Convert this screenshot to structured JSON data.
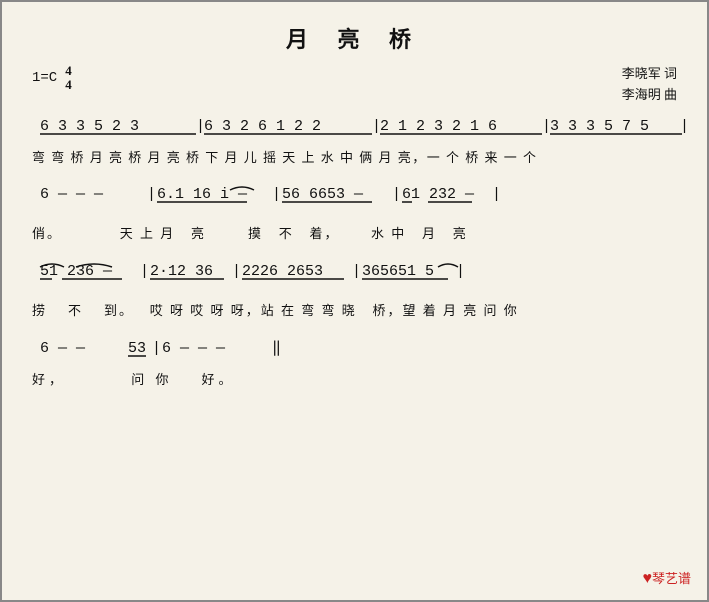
{
  "title": "月 亮 桥",
  "key": "1=C",
  "time_top": "4",
  "time_bottom": "4",
  "composer_lyric": "李晓军 词",
  "composer_music": "李海明 曲",
  "logo": "♥琴艺谱",
  "sections": [
    {
      "notation": "6̲ 3̲ 3̲ 5̲ 2̲ 3̲ | 6̲ 3̲ 2̲ 6̲ 1̲ 2̲ 2̲ | 2̲ 1̲ 2̲ 3̲ 2̲ 1̲ 6̲ | 3̲ 3̲ 3̲ 5̲ 7̲ 5̲ |",
      "lyrics": "弯弯桥月亮桥月亮桥下月儿摇天上水中俩月亮，一个桥来一个"
    },
    {
      "notation": "6  — — —  | 6̲.1̲ 1̲6̲ i —  | 5̲6̲ 6̲6̲5̲3̲ —  | 6̲1̲   2̲3̲2̲ —  |",
      "lyrics": "俏。           天上月  亮      摸  不  着，     水中  月  亮"
    },
    {
      "notation": "5̲1̲ 2̲3̲6̲ — |2̲·1̲2̲3̲6̲ | 2̲2̲2̲6̲ 2̲6̲5̲3̲| 3̲6̲5̲6̲5̲1̲5̲ |",
      "lyrics": "捞   不  到。  哎呀哎呀呀，站在弯弯晓  桥，望着月亮问你"
    },
    {
      "notation": "6  — —   5̲3̲ | 6  — — —  ‖",
      "lyrics": "好，       问你   好。"
    }
  ]
}
